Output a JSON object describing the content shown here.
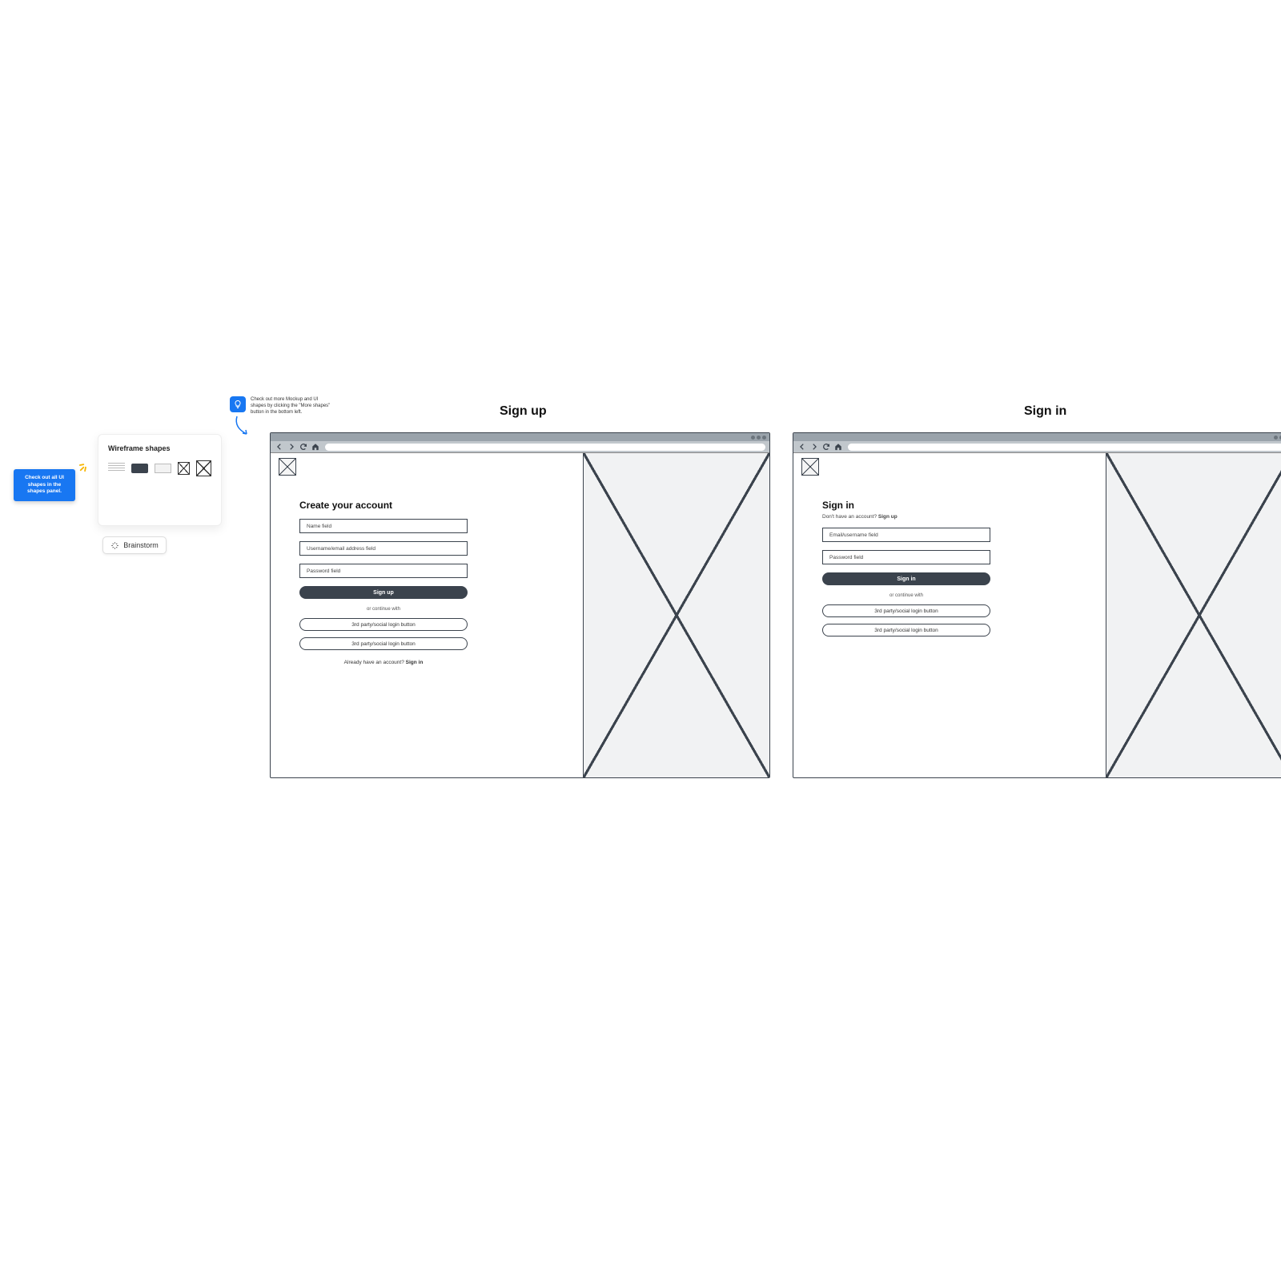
{
  "sticky": {
    "text": "Check out all UI shapes in the shapes panel."
  },
  "wireframe_card": {
    "title": "Wireframe shapes"
  },
  "brainstorm": {
    "label": "Brainstorm"
  },
  "tip": {
    "text": "Check out more Mockup and UI shapes by clicking the \"More shapes\" button in the bottom left."
  },
  "signup": {
    "heading": "Sign up",
    "form_title": "Create your account",
    "fields": {
      "name": "Name field",
      "username": "Username/email address field",
      "password": "Password field"
    },
    "primary": "Sign up",
    "divider": "or continue with",
    "social1": "3rd party/social login button",
    "social2": "3rd party/social login button",
    "footer_prefix": "Already have an account? ",
    "footer_link": "Sign in"
  },
  "signin": {
    "heading": "Sign in",
    "form_title": "Sign in",
    "sub_prefix": "Don't have an account? ",
    "sub_link": "Sign up",
    "fields": {
      "username": "Email/username field",
      "password": "Password field"
    },
    "primary": "Sign in",
    "divider": "or continue with",
    "social1": "3rd party/social login button",
    "social2": "3rd party/social login button"
  }
}
